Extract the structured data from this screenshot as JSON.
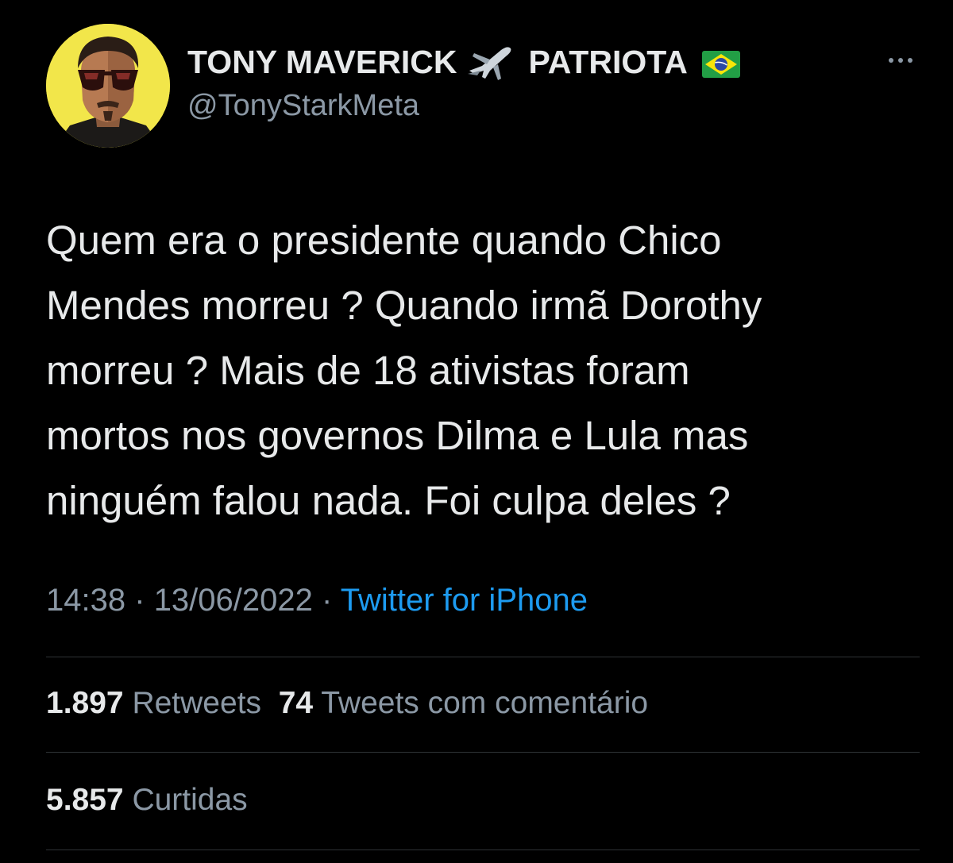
{
  "author": {
    "display_name_part1": "TONY MAVERICK",
    "display_name_part2": "PATRIOTA",
    "handle": "@TonyStarkMeta",
    "plane_icon": "airplane-emoji",
    "flag_icon": "brazil-flag-emoji"
  },
  "tweet": {
    "lines": [
      "Quem era o presidente quando Chico",
      "Mendes morreu ? Quando irmã Dorothy",
      "morreu ? Mais de 18 ativistas foram",
      "mortos nos governos Dilma e Lula mas",
      "ninguém falou nada. Foi culpa deles ?"
    ],
    "time": "14:38",
    "date": "13/06/2022",
    "separator": "·",
    "source": "Twitter for iPhone"
  },
  "stats": {
    "retweets_count": "1.897",
    "retweets_label": "Retweets",
    "quotes_count": "74",
    "quotes_label": "Tweets com comentário",
    "likes_count": "5.857",
    "likes_label": "Curtidas"
  },
  "colors": {
    "background": "#000000",
    "text": "#e7e9ea",
    "secondary": "#8b98a5",
    "link": "#1d9bf0",
    "divider": "#2f3336"
  }
}
